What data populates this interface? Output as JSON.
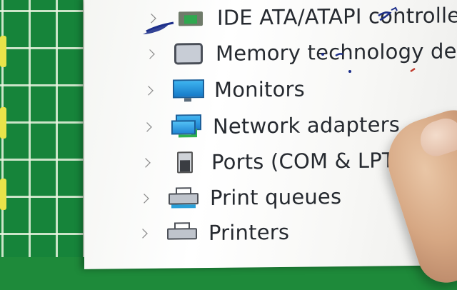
{
  "device_manager": {
    "categories": [
      {
        "label": "IDE ATA/ATAPI controllers",
        "icon": "ide-controller-icon"
      },
      {
        "label": "Memory technology devices",
        "icon": "memory-device-icon"
      },
      {
        "label": "Monitors",
        "icon": "monitor-icon"
      },
      {
        "label": "Network adapters",
        "icon": "network-adapter-icon"
      },
      {
        "label": "Ports (COM & LPT)",
        "icon": "port-icon"
      },
      {
        "label": "Print queues",
        "icon": "print-queue-icon"
      },
      {
        "label": "Printers",
        "icon": "printer-icon"
      }
    ]
  },
  "colors": {
    "mat_green": "#16843a",
    "screen_bg": "#f6f6f4",
    "text": "#262a30",
    "pen_ink": "#1d2f8a"
  }
}
